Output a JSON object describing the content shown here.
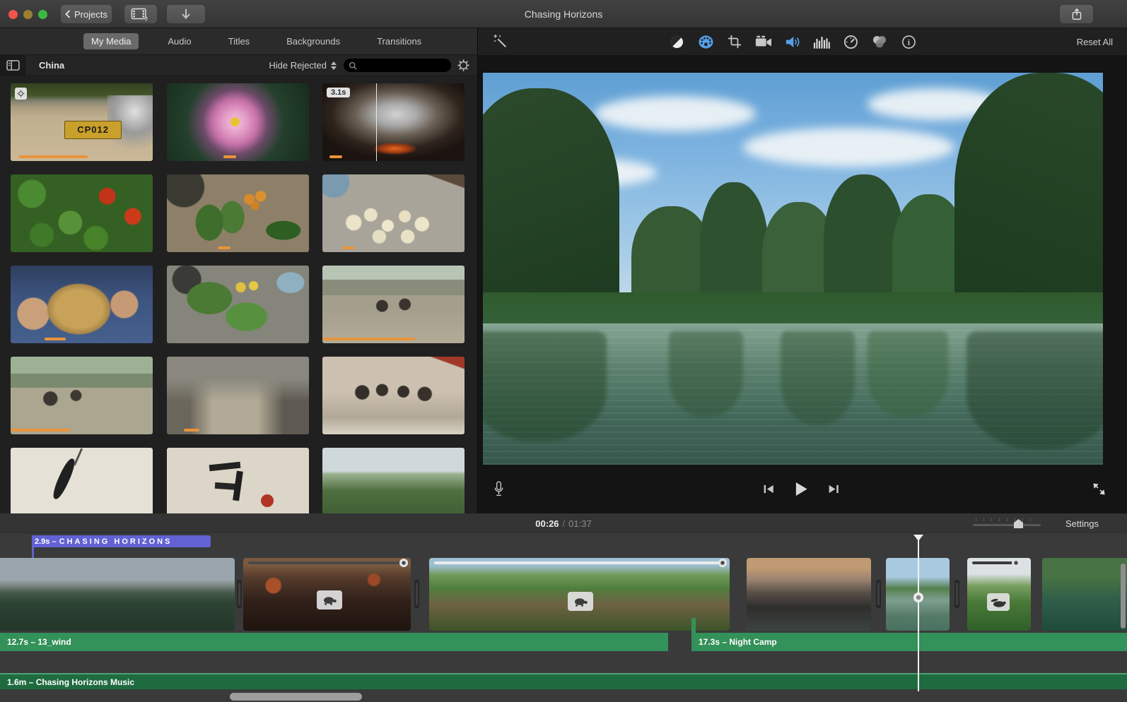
{
  "titlebar": {
    "projects_label": "Projects",
    "window_title": "Chasing Horizons"
  },
  "media_panel": {
    "tabs": [
      {
        "label": "My Media"
      },
      {
        "label": "Audio"
      },
      {
        "label": "Titles"
      },
      {
        "label": "Backgrounds"
      },
      {
        "label": "Transitions"
      }
    ],
    "event_name": "China",
    "filter_label": "Hide Rejected",
    "search_value": "",
    "duration_badge": "3.1s",
    "plate_text": "CP012"
  },
  "viewer": {
    "reset_all_label": "Reset All",
    "toolbar_icons": [
      "enhance-wand",
      "color-balance",
      "color-correction",
      "crop",
      "stabilization",
      "volume",
      "noise-reduction",
      "speed",
      "color-filters",
      "info"
    ],
    "active_icons": [
      "color-correction",
      "volume"
    ]
  },
  "transport": {
    "current_time": "00:26",
    "separator": "/",
    "total_time": "01:37",
    "settings_label": "Settings"
  },
  "timeline": {
    "title_clip_duration": "2.9s –",
    "title_clip_name": "CHASING HORIZONS",
    "audio_clip_1": "12.7s – 13_wind",
    "audio_clip_2": "17.3s – Night Camp",
    "music_clip": "1.6m – Chasing Horizons Music"
  },
  "icons": {
    "music_note": "♪",
    "down_arrow": "↓",
    "info_glyph": "i"
  },
  "colors": {
    "accent_blue": "#55a0e6",
    "title_clip_purple": "#6262d4",
    "audio_green": "#33915a",
    "music_green": "#1f6b40",
    "usage_orange": "#e8943a"
  }
}
